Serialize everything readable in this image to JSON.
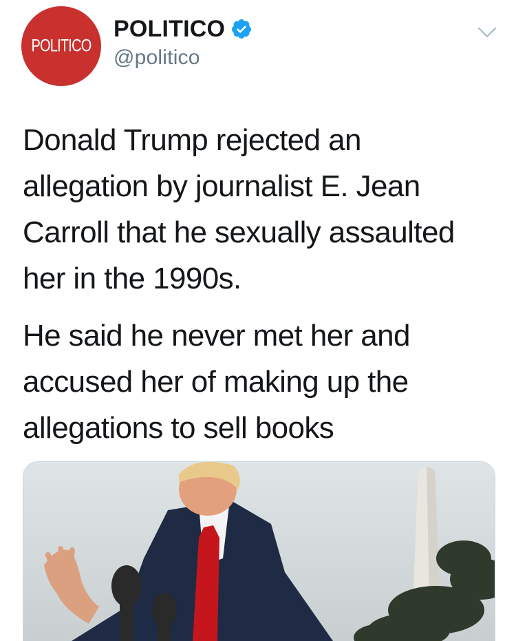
{
  "account": {
    "avatar_text": "POLITICO",
    "display_name": "POLITICO",
    "handle": "@politico",
    "verified": true
  },
  "icons": {
    "verified": "verified-badge-icon",
    "menu": "chevron-down-icon"
  },
  "tweet": {
    "paragraphs": [
      "Donald Trump rejected an allegation by journalist E. Jean Carroll that he sexually assaulted her in the 1990s.",
      "He said he never met her and accused her of making up the allegations to sell books"
    ]
  },
  "media": {
    "kind": "photo",
    "description_icon": "photo"
  },
  "colors": {
    "brand_red": "#c8312e",
    "verified_blue": "#1da1f2",
    "text": "#14171a",
    "secondary_text": "#657786"
  }
}
